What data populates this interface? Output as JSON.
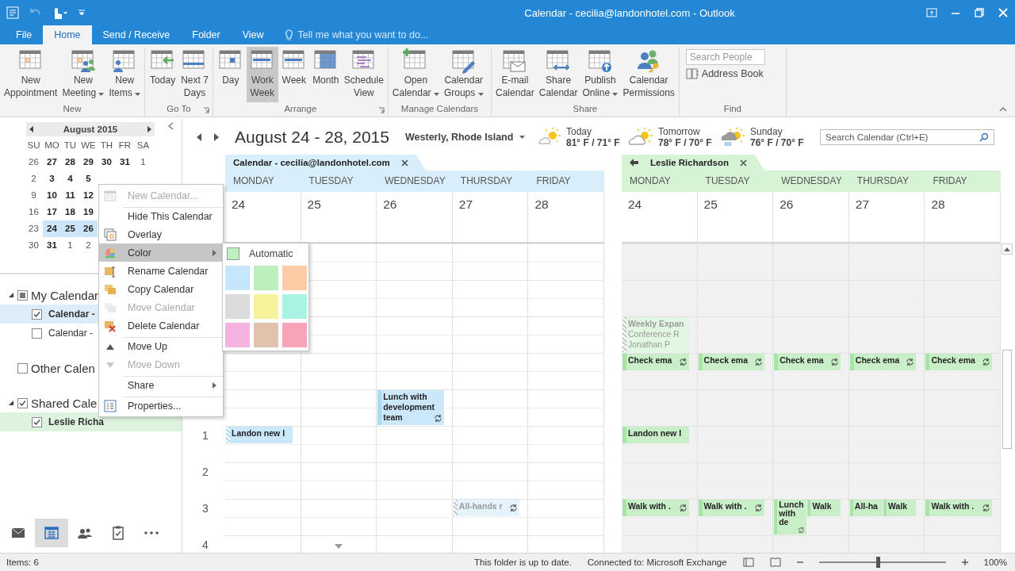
{
  "window": {
    "title": "Calendar - cecilia@landonhotel.com - Outlook"
  },
  "tabs": [
    {
      "label": "File",
      "selected": false
    },
    {
      "label": "Home",
      "selected": true
    },
    {
      "label": "Send / Receive",
      "selected": false
    },
    {
      "label": "Folder",
      "selected": false
    },
    {
      "label": "View",
      "selected": false
    }
  ],
  "tell_me": {
    "placeholder": "Tell me what you want to do..."
  },
  "ribbon": [
    {
      "label": "New",
      "launcher": false,
      "buttons": [
        {
          "label": [
            "New",
            "Appointment"
          ],
          "dropdown": false,
          "selected": false
        },
        {
          "label": [
            "New",
            "Meeting"
          ],
          "dropdown": true,
          "selected": false
        },
        {
          "label": [
            "New",
            "Items"
          ],
          "dropdown": true,
          "selected": false
        }
      ]
    },
    {
      "label": "Go To",
      "launcher": true,
      "buttons": [
        {
          "label": [
            "Today"
          ],
          "dropdown": false,
          "selected": false
        },
        {
          "label": [
            "Next 7",
            "Days"
          ],
          "dropdown": false,
          "selected": false
        }
      ]
    },
    {
      "label": "Arrange",
      "launcher": true,
      "buttons": [
        {
          "label": [
            "Day"
          ],
          "dropdown": false,
          "selected": false
        },
        {
          "label": [
            "Work",
            "Week"
          ],
          "dropdown": false,
          "selected": true
        },
        {
          "label": [
            "Week"
          ],
          "dropdown": false,
          "selected": false
        },
        {
          "label": [
            "Month"
          ],
          "dropdown": false,
          "selected": false
        },
        {
          "label": [
            "Schedule",
            "View"
          ],
          "dropdown": false,
          "selected": false
        }
      ]
    },
    {
      "label": "Manage Calendars",
      "launcher": false,
      "buttons": [
        {
          "label": [
            "Open",
            "Calendar"
          ],
          "dropdown": true,
          "selected": false
        },
        {
          "label": [
            "Calendar",
            "Groups"
          ],
          "dropdown": true,
          "selected": false
        }
      ]
    },
    {
      "label": "Share",
      "launcher": false,
      "buttons": [
        {
          "label": [
            "E-mail",
            "Calendar"
          ],
          "dropdown": false,
          "selected": false
        },
        {
          "label": [
            "Share",
            "Calendar"
          ],
          "dropdown": false,
          "selected": false
        },
        {
          "label": [
            "Publish",
            "Online"
          ],
          "dropdown": true,
          "selected": false
        },
        {
          "label": [
            "Calendar",
            "Permissions"
          ],
          "dropdown": false,
          "selected": false
        }
      ]
    }
  ],
  "find": {
    "label": "Find",
    "search": {
      "placeholder": "Search People"
    },
    "address_book": "Address Book"
  },
  "mini_calendar": {
    "title": "August 2015",
    "weekdays": [
      "SU",
      "MO",
      "TU",
      "WE",
      "TH",
      "FR",
      "SA"
    ],
    "weeks": [
      {
        "days": [
          {
            "label": "26",
            "bold": false,
            "selected": false
          },
          {
            "label": "27",
            "bold": true,
            "selected": false
          },
          {
            "label": "28",
            "bold": true,
            "selected": false
          },
          {
            "label": "29",
            "bold": true,
            "selected": false
          },
          {
            "label": "30",
            "bold": true,
            "selected": false
          },
          {
            "label": "31",
            "bold": true,
            "selected": false
          },
          {
            "label": "1",
            "bold": false,
            "selected": false
          }
        ]
      },
      {
        "days": [
          {
            "label": "2",
            "bold": false,
            "selected": false
          },
          {
            "label": "3",
            "bold": true,
            "selected": false
          },
          {
            "label": "4",
            "bold": true,
            "selected": false
          },
          {
            "label": "5",
            "bold": true,
            "selected": false
          }
        ]
      },
      {
        "days": [
          {
            "label": "9",
            "bold": false,
            "selected": false
          },
          {
            "label": "10",
            "bold": true,
            "selected": false
          },
          {
            "label": "11",
            "bold": true,
            "selected": false
          },
          {
            "label": "12",
            "bold": true,
            "selected": false
          }
        ]
      },
      {
        "days": [
          {
            "label": "16",
            "bold": false,
            "selected": false
          },
          {
            "label": "17",
            "bold": true,
            "selected": false
          },
          {
            "label": "18",
            "bold": true,
            "selected": false
          },
          {
            "label": "19",
            "bold": true,
            "selected": false
          }
        ]
      },
      {
        "days": [
          {
            "label": "23",
            "bold": false,
            "selected": false
          },
          {
            "label": "24",
            "bold": true,
            "selected": true
          },
          {
            "label": "25",
            "bold": true,
            "selected": true
          },
          {
            "label": "26",
            "bold": true,
            "selected": true
          }
        ]
      },
      {
        "days": [
          {
            "label": "30",
            "bold": false,
            "selected": false
          },
          {
            "label": "31",
            "bold": true,
            "selected": false
          },
          {
            "label": "1",
            "bold": false,
            "selected": false
          },
          {
            "label": "2",
            "bold": false,
            "selected": false
          }
        ]
      }
    ]
  },
  "folders": [
    {
      "label": "My Calendar",
      "partial": true,
      "expanded": true,
      "items": [
        {
          "label": "Calendar -",
          "checked": true,
          "bold": true,
          "color": "#dcedf9"
        },
        {
          "label": "Calendar -",
          "checked": false,
          "bold": false
        }
      ]
    },
    {
      "label": "Other Calen",
      "checked": false,
      "expanded": false
    },
    {
      "label": "Shared Cale",
      "checked": true,
      "expanded": true,
      "items": [
        {
          "label": "Leslie Richa",
          "checked": true,
          "bold": true,
          "color": "#def3de"
        }
      ]
    }
  ],
  "nav": [
    {
      "kind": "mail",
      "selected": false
    },
    {
      "kind": "calendar",
      "selected": true
    },
    {
      "kind": "people",
      "selected": false
    },
    {
      "kind": "tasks",
      "selected": false
    },
    {
      "kind": "more",
      "selected": false
    }
  ],
  "header": {
    "range": "August 24 - 28, 2015",
    "location": "Westerly, Rhode Island",
    "weather": [
      {
        "kind": "sunny",
        "day": "Today",
        "temps": "81° F / 71° F"
      },
      {
        "kind": "partly",
        "day": "Tomorrow",
        "temps": "78° F / 70° F"
      },
      {
        "kind": "storm",
        "day": "Sunday",
        "temps": "76° F / 70° F"
      }
    ],
    "search": {
      "placeholder": "Search Calendar (Ctrl+E)"
    }
  },
  "hour_labels": [
    "1",
    "2",
    "3",
    "4"
  ],
  "calendars": [
    {
      "name": "Calendar - cecilia@landonhotel.com",
      "kind": "own",
      "color": "#d8eefb",
      "days": [
        {
          "name": "MONDAY",
          "date": "24",
          "more_below": false,
          "timeline": [
            {
              "kind": "gap"
            },
            {
              "kind": "gap"
            },
            {
              "kind": "gap"
            },
            {
              "kind": "gap"
            },
            {
              "kind": "gap"
            },
            {
              "kind": "gap"
            },
            {
              "kind": "gap"
            },
            {
              "kind": "gap"
            },
            {
              "kind": "gap"
            },
            {
              "kind": "gap"
            },
            {
              "kind": "block",
              "events": [
                {
                  "title": "Landon new I",
                  "kind": "tentative",
                  "long": false,
                  "recurring": false
                }
              ]
            }
          ]
        },
        {
          "name": "TUESDAY",
          "date": "25",
          "more_below": true
        },
        {
          "name": "WEDNESDAY",
          "date": "26",
          "more_below": false,
          "timeline": [
            {
              "kind": "gap"
            },
            {
              "kind": "gap"
            },
            {
              "kind": "gap"
            },
            {
              "kind": "gap"
            },
            {
              "kind": "gap"
            },
            {
              "kind": "gap"
            },
            {
              "kind": "gap"
            },
            {
              "kind": "gap"
            },
            {
              "kind": "block",
              "events": [
                {
                  "title": "Lunch with development team",
                  "kind": "busy",
                  "long": true,
                  "recurring": true
                }
              ]
            }
          ]
        },
        {
          "name": "THURSDAY",
          "date": "27",
          "more_below": false,
          "timeline": [
            {
              "kind": "gap"
            },
            {
              "kind": "gap"
            },
            {
              "kind": "gap"
            },
            {
              "kind": "gap"
            },
            {
              "kind": "gap"
            },
            {
              "kind": "gap"
            },
            {
              "kind": "gap"
            },
            {
              "kind": "gap"
            },
            {
              "kind": "gap"
            },
            {
              "kind": "gap"
            },
            {
              "kind": "gap"
            },
            {
              "kind": "gap"
            },
            {
              "kind": "gap"
            },
            {
              "kind": "gap"
            },
            {
              "kind": "block",
              "events": [
                {
                  "title": "All-hands r",
                  "kind": "free",
                  "long": false,
                  "recurring": true
                }
              ]
            }
          ]
        },
        {
          "name": "FRIDAY",
          "date": "28",
          "more_below": false
        }
      ]
    },
    {
      "name": "Leslie Richardson",
      "kind": "shared",
      "color": "#d6f3d6",
      "days": [
        {
          "name": "MONDAY",
          "date": "24",
          "more_below": false,
          "timeline": [
            {
              "kind": "gap"
            },
            {
              "kind": "gap"
            },
            {
              "kind": "gap"
            },
            {
              "kind": "gap"
            },
            {
              "kind": "block",
              "events": [
                {
                  "title": "Weekly Expan",
                  "details": [
                    "Conference R",
                    "Jonathan P"
                  ],
                  "kind": "free",
                  "long": true,
                  "recurring": false
                }
              ]
            },
            {
              "kind": "block",
              "events": [
                {
                  "title": "Check ema",
                  "kind": "busy",
                  "long": false,
                  "recurring": true
                }
              ]
            },
            {
              "kind": "gap"
            },
            {
              "kind": "gap"
            },
            {
              "kind": "gap"
            },
            {
              "kind": "block",
              "events": [
                {
                  "title": "Landon new I",
                  "kind": "busy",
                  "long": false,
                  "recurring": false
                }
              ]
            },
            {
              "kind": "gap"
            },
            {
              "kind": "gap"
            },
            {
              "kind": "gap"
            },
            {
              "kind": "block",
              "events": [
                {
                  "title": "Walk with .",
                  "kind": "busy",
                  "long": false,
                  "recurring": true
                }
              ]
            }
          ]
        },
        {
          "name": "TUESDAY",
          "date": "25",
          "more_below": false,
          "timeline": [
            {
              "kind": "gap"
            },
            {
              "kind": "gap"
            },
            {
              "kind": "gap"
            },
            {
              "kind": "gap"
            },
            {
              "kind": "gap"
            },
            {
              "kind": "gap"
            },
            {
              "kind": "block",
              "events": [
                {
                  "title": "Check ema",
                  "kind": "busy",
                  "long": false,
                  "recurring": true
                }
              ]
            },
            {
              "kind": "gap"
            },
            {
              "kind": "gap"
            },
            {
              "kind": "gap"
            },
            {
              "kind": "gap"
            },
            {
              "kind": "gap"
            },
            {
              "kind": "gap"
            },
            {
              "kind": "gap"
            },
            {
              "kind": "block",
              "events": [
                {
                  "title": "Walk with .",
                  "kind": "busy",
                  "long": false,
                  "recurring": true
                }
              ]
            }
          ]
        },
        {
          "name": "WEDNESDAY",
          "date": "26",
          "more_below": false,
          "timeline": [
            {
              "kind": "gap"
            },
            {
              "kind": "gap"
            },
            {
              "kind": "gap"
            },
            {
              "kind": "gap"
            },
            {
              "kind": "gap"
            },
            {
              "kind": "gap"
            },
            {
              "kind": "block",
              "events": [
                {
                  "title": "Check ema",
                  "kind": "busy",
                  "long": false,
                  "recurring": true
                }
              ]
            },
            {
              "kind": "gap"
            },
            {
              "kind": "gap"
            },
            {
              "kind": "gap"
            },
            {
              "kind": "gap"
            },
            {
              "kind": "gap"
            },
            {
              "kind": "gap"
            },
            {
              "kind": "gap"
            },
            {
              "kind": "block",
              "events": [
                {
                  "title": "Lunch with de",
                  "kind": "busy",
                  "long": true,
                  "recurring": true
                },
                {
                  "title": "Walk",
                  "kind": "busy",
                  "long": false,
                  "recurring": false
                }
              ]
            }
          ]
        },
        {
          "name": "THURSDAY",
          "date": "27",
          "more_below": false,
          "timeline": [
            {
              "kind": "gap"
            },
            {
              "kind": "gap"
            },
            {
              "kind": "gap"
            },
            {
              "kind": "gap"
            },
            {
              "kind": "gap"
            },
            {
              "kind": "gap"
            },
            {
              "kind": "block",
              "events": [
                {
                  "title": "Check ema",
                  "kind": "busy",
                  "long": false,
                  "recurring": true
                }
              ]
            },
            {
              "kind": "gap"
            },
            {
              "kind": "gap"
            },
            {
              "kind": "gap"
            },
            {
              "kind": "gap"
            },
            {
              "kind": "gap"
            },
            {
              "kind": "gap"
            },
            {
              "kind": "gap"
            },
            {
              "kind": "block",
              "events": [
                {
                  "title": "All-ha",
                  "kind": "busy",
                  "long": false,
                  "recurring": false
                },
                {
                  "title": "Walk",
                  "kind": "busy",
                  "long": false,
                  "recurring": false
                }
              ]
            }
          ]
        },
        {
          "name": "FRIDAY",
          "date": "28",
          "more_below": false,
          "timeline": [
            {
              "kind": "gap"
            },
            {
              "kind": "gap"
            },
            {
              "kind": "gap"
            },
            {
              "kind": "gap"
            },
            {
              "kind": "gap"
            },
            {
              "kind": "gap"
            },
            {
              "kind": "block",
              "events": [
                {
                  "title": "Check ema",
                  "kind": "busy",
                  "long": false,
                  "recurring": true
                }
              ]
            },
            {
              "kind": "gap"
            },
            {
              "kind": "gap"
            },
            {
              "kind": "gap"
            },
            {
              "kind": "gap"
            },
            {
              "kind": "gap"
            },
            {
              "kind": "gap"
            },
            {
              "kind": "gap"
            },
            {
              "kind": "block",
              "events": [
                {
                  "title": "Walk with .",
                  "kind": "busy",
                  "long": false,
                  "recurring": true
                }
              ]
            }
          ]
        }
      ]
    }
  ],
  "context_menu": [
    {
      "label": "New Calendar...",
      "disabled": true,
      "selected": false,
      "submenu": false,
      "divider_above": false
    },
    {
      "label": "Hide This Calendar",
      "disabled": false,
      "selected": false,
      "submenu": false,
      "divider_above": true
    },
    {
      "label": "Overlay",
      "disabled": false,
      "selected": false,
      "submenu": false,
      "divider_above": false
    },
    {
      "label": "Color",
      "disabled": false,
      "selected": true,
      "submenu": true,
      "divider_above": false
    },
    {
      "label": "Rename Calendar",
      "disabled": false,
      "selected": false,
      "submenu": false,
      "divider_above": false
    },
    {
      "label": "Copy Calendar",
      "disabled": false,
      "selected": false,
      "submenu": false,
      "divider_above": false
    },
    {
      "label": "Move Calendar",
      "disabled": true,
      "selected": false,
      "submenu": false,
      "divider_above": false
    },
    {
      "label": "Delete Calendar",
      "disabled": false,
      "selected": false,
      "submenu": false,
      "divider_above": false
    },
    {
      "label": "Move Up",
      "disabled": false,
      "selected": false,
      "submenu": false,
      "divider_above": true
    },
    {
      "label": "Move Down",
      "disabled": true,
      "selected": false,
      "submenu": false,
      "divider_above": false
    },
    {
      "label": "Share",
      "disabled": false,
      "selected": false,
      "submenu": true,
      "divider_above": true
    },
    {
      "label": "Properties...",
      "disabled": false,
      "selected": false,
      "submenu": false,
      "divider_above": true
    }
  ],
  "color_menu": {
    "automatic": {
      "label": "Automatic",
      "color": "#bfeebf"
    },
    "swatches": [
      {
        "color": "#c6e7fb"
      },
      {
        "color": "#bdefbd"
      },
      {
        "color": "#fdcba6"
      },
      {
        "color": "#dcdcdc"
      },
      {
        "color": "#f7f29c"
      },
      {
        "color": "#a9f3e3"
      },
      {
        "color": "#f6b2e0"
      },
      {
        "color": "#e2c1ad"
      },
      {
        "color": "#f8a4b8"
      }
    ]
  },
  "status_bar": {
    "items": "Items: 6",
    "sync": "This folder is up to date.",
    "connection": "Connected to: Microsoft Exchange",
    "zoom": {
      "level": 0.45
    },
    "zoom_label": "100%"
  }
}
